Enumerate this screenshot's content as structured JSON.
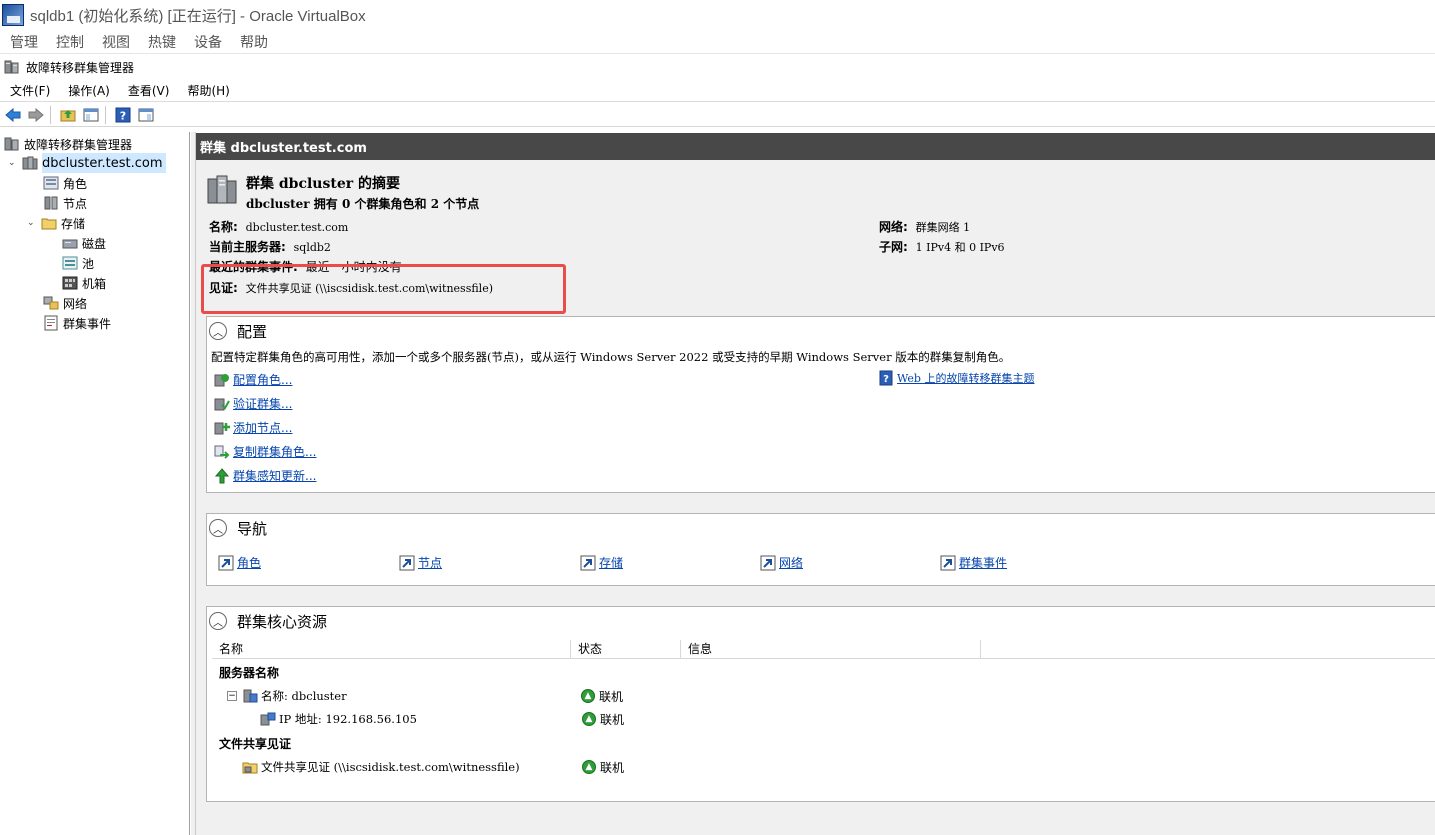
{
  "vbox": {
    "title": "sqldb1 (初始化系统) [正在运行] - Oracle VirtualBox",
    "menu": [
      "管理",
      "控制",
      "视图",
      "热键",
      "设备",
      "帮助"
    ]
  },
  "mmc": {
    "title": "故障转移群集管理器",
    "menu": [
      "文件(F)",
      "操作(A)",
      "查看(V)",
      "帮助(H)"
    ]
  },
  "tree": {
    "root": "故障转移群集管理器",
    "cluster": "dbcluster.test.com",
    "roles": "角色",
    "nodes": "节点",
    "storage": "存储",
    "disks": "磁盘",
    "pools": "池",
    "enclosures": "机箱",
    "networks": "网络",
    "events": "群集事件"
  },
  "header": {
    "title": "群集 dbcluster.test.com"
  },
  "summary": {
    "heading": "群集 dbcluster 的摘要",
    "subheading": "dbcluster 拥有 0 个群集角色和 2 个节点",
    "name_label": "名称:",
    "name_value": "dbcluster.test.com",
    "host_label": "当前主服务器:",
    "host_value": "sqldb2",
    "events_label": "最近的群集事件:",
    "events_value": "最近一小时内没有",
    "witness_label": "见证:",
    "witness_value": "文件共享见证 (\\\\iscsidisk.test.com\\witnessfile)",
    "network_label": "网络:",
    "network_value": "群集网络 1",
    "subnet_label": "子网:",
    "subnet_value": "1 IPv4 和 0 IPv6"
  },
  "config": {
    "title": "配置",
    "description": "配置特定群集角色的高可用性，添加一个或多个服务器(节点)，或从运行 Windows Server 2022 或受支持的早期 Windows Server 版本的群集复制角色。",
    "links": [
      "配置角色...",
      "验证群集...",
      "添加节点...",
      "复制群集角色...",
      "群集感知更新..."
    ],
    "web_link": "Web 上的故障转移群集主题"
  },
  "navigation": {
    "title": "导航",
    "links": [
      "角色",
      "节点",
      "存储",
      "网络",
      "群集事件"
    ]
  },
  "resources": {
    "title": "群集核心资源",
    "columns": [
      "名称",
      "状态",
      "信息"
    ],
    "group_server": "服务器名称",
    "server_name": "名称: dbcluster",
    "ip": "IP 地址: 192.168.56.105",
    "group_witness": "文件共享见证",
    "witness": "文件共享见证 (\\\\iscsidisk.test.com\\witnessfile)",
    "status_online": "联机"
  }
}
